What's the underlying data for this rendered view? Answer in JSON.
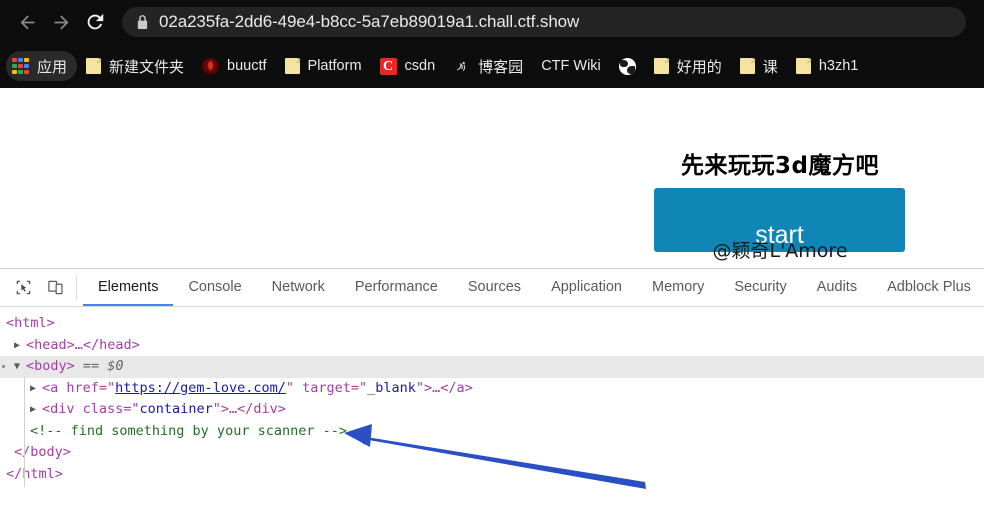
{
  "browser": {
    "nav": {
      "back_label": "Back",
      "forward_label": "Forward",
      "reload_label": "Reload"
    },
    "omnibox": {
      "url": "02a235fa-2dd6-49e4-b8cc-5a7eb89019a1.chall.ctf.show",
      "security_icon": "lock-icon"
    },
    "bookmarks": [
      {
        "label": "应用",
        "icon": "apps-grid-icon",
        "type": "apps"
      },
      {
        "label": "新建文件夹",
        "icon": "folder-icon",
        "type": "folder"
      },
      {
        "label": "buuctf",
        "icon": "buuctf-favicon",
        "type": "favicon"
      },
      {
        "label": "Platform",
        "icon": "folder-icon",
        "type": "folder"
      },
      {
        "label": "csdn",
        "icon": "csdn-favicon",
        "type": "csdn"
      },
      {
        "label": "博客园",
        "icon": "cnblogs-favicon",
        "type": "cnblogs"
      },
      {
        "label": "CTF Wiki",
        "icon": "none",
        "type": "none"
      },
      {
        "label": "",
        "icon": "globe-favicon",
        "type": "globe"
      },
      {
        "label": "好用的",
        "icon": "folder-icon",
        "type": "folder"
      },
      {
        "label": "课",
        "icon": "folder-icon",
        "type": "folder"
      },
      {
        "label": "h3zh1",
        "icon": "folder-icon",
        "type": "folder"
      }
    ]
  },
  "page": {
    "heading": "先来玩玩3d魔方吧",
    "start_button": "start",
    "watermark": "@颖奇L'Amore",
    "accent_color": "#0f86b5"
  },
  "devtools": {
    "tool_icons": [
      {
        "name": "inspect-element-icon"
      },
      {
        "name": "device-toolbar-icon"
      }
    ],
    "tabs": [
      {
        "label": "Elements",
        "active": true
      },
      {
        "label": "Console",
        "active": false
      },
      {
        "label": "Network",
        "active": false
      },
      {
        "label": "Performance",
        "active": false
      },
      {
        "label": "Sources",
        "active": false
      },
      {
        "label": "Application",
        "active": false
      },
      {
        "label": "Memory",
        "active": false
      },
      {
        "label": "Security",
        "active": false
      },
      {
        "label": "Audits",
        "active": false
      },
      {
        "label": "Adblock Plus",
        "active": false
      }
    ],
    "dom": {
      "row_html_open": "<html>",
      "row_head": "<head>…</head>",
      "row_body_tag": "<body>",
      "row_body_selected_marker": "== $0",
      "row_anchor": {
        "open": "<a href=\"",
        "href": "https://gem-love.com/",
        "mid": "\" target=\"",
        "target": "_blank",
        "close": "\">…</a>"
      },
      "row_div": {
        "open": "<div class=\"",
        "class": "container",
        "close": "\">…</div>"
      },
      "row_comment": "<!-- find something by your scanner -->",
      "row_body_close": "</body>",
      "row_html_close": "</html>"
    },
    "annotation": {
      "arrow_color": "#2a4fc4",
      "name": "pointer-arrow-to-comment"
    }
  }
}
